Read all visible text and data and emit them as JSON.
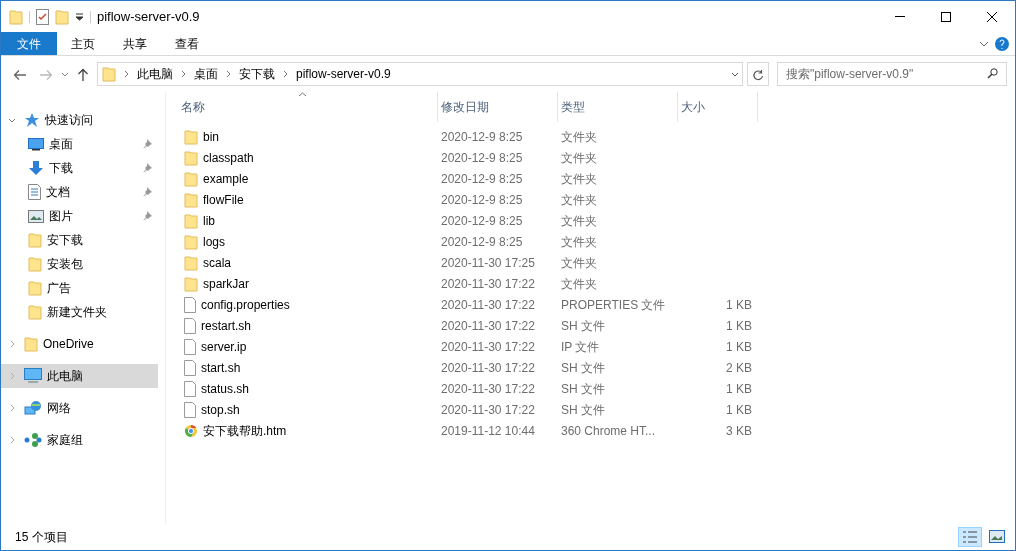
{
  "window": {
    "title": "piflow-server-v0.9"
  },
  "ribbon": {
    "file_tab": "文件",
    "tabs": [
      {
        "label": "主页",
        "selected": false
      },
      {
        "label": "共享",
        "selected": false
      },
      {
        "label": "查看",
        "selected": false
      }
    ]
  },
  "address": {
    "crumbs": [
      "此电脑",
      "桌面",
      "安下载",
      "piflow-server-v0.9"
    ]
  },
  "search": {
    "placeholder": "搜索\"piflow-server-v0.9\""
  },
  "sidebar": {
    "items": [
      {
        "label": "快速访问",
        "kind": "star",
        "expanded": true,
        "selected": false,
        "children": [
          {
            "label": "桌面",
            "kind": "desktop",
            "pinned": true,
            "selected": false
          },
          {
            "label": "下载",
            "kind": "download",
            "pinned": true,
            "selected": false
          },
          {
            "label": "文档",
            "kind": "document",
            "pinned": true,
            "selected": false
          },
          {
            "label": "图片",
            "kind": "picture",
            "pinned": true,
            "selected": false
          },
          {
            "label": "安下载",
            "kind": "folder",
            "pinned": false,
            "selected": false
          },
          {
            "label": "安装包",
            "kind": "folder",
            "pinned": false,
            "selected": false
          },
          {
            "label": "广告",
            "kind": "folder",
            "pinned": false,
            "selected": false
          },
          {
            "label": "新建文件夹",
            "kind": "folder",
            "pinned": false,
            "selected": false
          }
        ]
      },
      {
        "label": "OneDrive",
        "kind": "folder",
        "expanded": false,
        "selected": false
      },
      {
        "label": "此电脑",
        "kind": "computer",
        "expanded": false,
        "selected": true
      },
      {
        "label": "网络",
        "kind": "network",
        "expanded": false,
        "selected": false
      },
      {
        "label": "家庭组",
        "kind": "homegroup",
        "expanded": false,
        "selected": false
      }
    ]
  },
  "table": {
    "columns": [
      "名称",
      "修改日期",
      "类型",
      "大小"
    ],
    "rows": [
      {
        "kind": "folder",
        "name": "bin",
        "modified": "2020-12-9 8:25",
        "type": "文件夹"
      },
      {
        "kind": "folder",
        "name": "classpath",
        "modified": "2020-12-9 8:25",
        "type": "文件夹"
      },
      {
        "kind": "folder",
        "name": "example",
        "modified": "2020-12-9 8:25",
        "type": "文件夹"
      },
      {
        "kind": "folder",
        "name": "flowFile",
        "modified": "2020-12-9 8:25",
        "type": "文件夹"
      },
      {
        "kind": "folder",
        "name": "lib",
        "modified": "2020-12-9 8:25",
        "type": "文件夹"
      },
      {
        "kind": "folder",
        "name": "logs",
        "modified": "2020-12-9 8:25",
        "type": "文件夹"
      },
      {
        "kind": "folder",
        "name": "scala",
        "modified": "2020-11-30 17:25",
        "type": "文件夹"
      },
      {
        "kind": "folder",
        "name": "sparkJar",
        "modified": "2020-11-30 17:22",
        "type": "文件夹"
      },
      {
        "kind": "file",
        "name": "config.properties",
        "modified": "2020-11-30 17:22",
        "type": "PROPERTIES 文件",
        "size": "1 KB"
      },
      {
        "kind": "file",
        "name": "restart.sh",
        "modified": "2020-11-30 17:22",
        "type": "SH 文件",
        "size": "1 KB"
      },
      {
        "kind": "file",
        "name": "server.ip",
        "modified": "2020-11-30 17:22",
        "type": "IP 文件",
        "size": "1 KB"
      },
      {
        "kind": "file",
        "name": "start.sh",
        "modified": "2020-11-30 17:22",
        "type": "SH 文件",
        "size": "2 KB"
      },
      {
        "kind": "file",
        "name": "status.sh",
        "modified": "2020-11-30 17:22",
        "type": "SH 文件",
        "size": "1 KB"
      },
      {
        "kind": "file",
        "name": "stop.sh",
        "modified": "2020-11-30 17:22",
        "type": "SH 文件",
        "size": "1 KB"
      },
      {
        "kind": "web",
        "name": "安下载帮助.htm",
        "modified": "2019-11-12 10:44",
        "type": "360 Chrome HT...",
        "size": "3 KB"
      }
    ]
  },
  "status_bar": {
    "count": "15 个项目",
    "views": [
      {
        "kind": "details",
        "selected": true
      },
      {
        "kind": "large_icons",
        "selected": false
      }
    ]
  }
}
